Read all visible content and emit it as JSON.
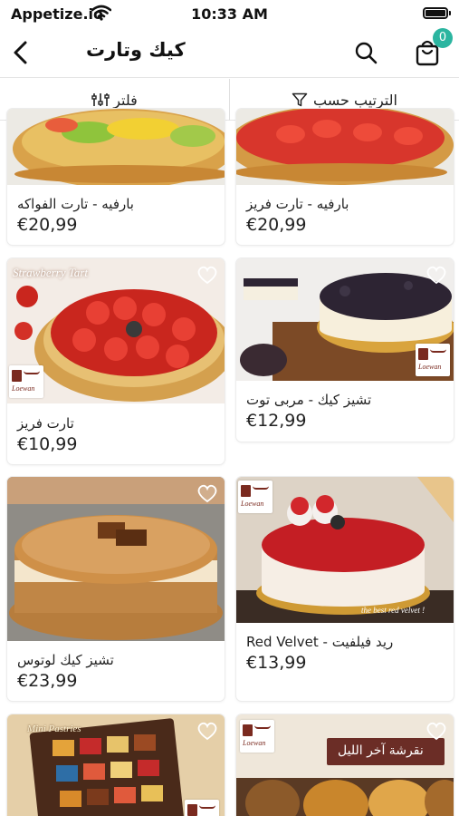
{
  "status_bar": {
    "carrier": "Appetize.io",
    "time": "10:33 AM"
  },
  "header": {
    "title": "كيك وتارت",
    "cart_count": "0"
  },
  "toolbar": {
    "sort_label": "الترتيب حسب",
    "filter_label": "فلتر"
  },
  "colors": {
    "accent": "#2bb5a0",
    "text": "#222222",
    "divider": "#e4e4e4"
  },
  "products": [
    {
      "name": "بارفيه - تارت الفواكه",
      "price": "€20,99"
    },
    {
      "name": "بارفيه - تارت فريز",
      "price": "€20,99"
    },
    {
      "name": "تارت فريز",
      "price": "€10,99",
      "photo_caption": "Strawberry Tart"
    },
    {
      "name": "تشيز كيك - مربى توت",
      "price": "€12,99"
    },
    {
      "name": "تشيز كيك لوتوس",
      "price": "€23,99"
    },
    {
      "name": "Red Velvet - ريد فيلفيت",
      "price": "€13,99",
      "photo_caption": "the best red velvet !"
    },
    {
      "name": "",
      "price": "",
      "photo_caption": "Mini Pastries"
    },
    {
      "name": "",
      "price": "",
      "photo_caption": "نقرشة آخر الليل"
    }
  ],
  "icons": [
    "wifi-icon",
    "battery-icon",
    "back-arrow-icon",
    "search-icon",
    "shopping-bag-icon",
    "sort-funnel-icon",
    "filter-sliders-icon",
    "heart-icon"
  ]
}
